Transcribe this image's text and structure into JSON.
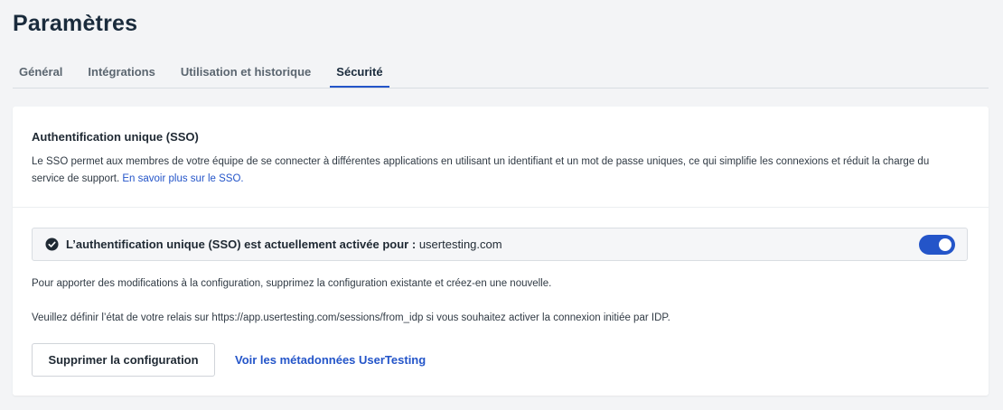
{
  "page": {
    "title": "Paramètres"
  },
  "tabs": [
    {
      "label": "Général"
    },
    {
      "label": "Intégrations"
    },
    {
      "label": "Utilisation et historique"
    },
    {
      "label": "Sécurité",
      "active": true
    }
  ],
  "sso": {
    "title": "Authentification unique (SSO)",
    "description": "Le SSO permet aux membres de votre équipe de se connecter à différentes applications en utilisant un identifiant et un mot de passe uniques, ce qui simplifie les connexions et réduit la charge du service de support.",
    "learn_more_link": "En savoir plus sur le SSO.",
    "status": {
      "icon": "check-circle-icon",
      "label": "L’authentification unique (SSO) est actuellement activée pour :",
      "domain": "usertesting.com",
      "enabled": true
    },
    "info_modify": "Pour apporter des modifications à la configuration, supprimez la configuration existante et créez-en une nouvelle.",
    "info_relay": "Veuillez définir l’état de votre relais sur https://app.usertesting.com/sessions/from_idp si vous souhaitez activer la connexion initiée par IDP.",
    "delete_button": "Supprimer la configuration",
    "metadata_link": "Voir les métadonnées UserTesting"
  },
  "colors": {
    "accent": "#2455c9",
    "title": "#1a2b3c",
    "background": "#f3f4f6"
  }
}
